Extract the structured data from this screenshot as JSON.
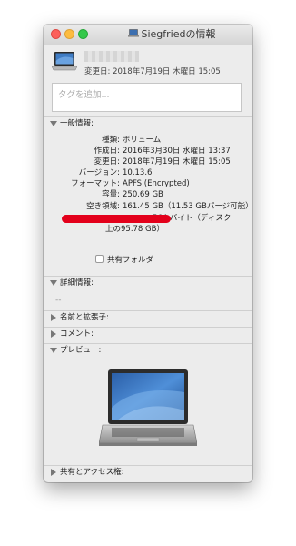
{
  "window": {
    "title": "Siegfriedの情報",
    "modified_line": "変更日:  2018年7月19日 木曜日 15:05",
    "tags_placeholder": "タグを追加..."
  },
  "sections": {
    "general": "一般情報:",
    "more_info": "詳細情報:",
    "more_info_value": "--",
    "name_ext": "名前と拡張子:",
    "comments": "コメント:",
    "preview": "プレビュー:",
    "sharing": "共有とアクセス権:"
  },
  "general": {
    "kind_key": "種類:",
    "kind_val": "ボリューム",
    "created_key": "作成日:",
    "created_val": "2016年3月30日 水曜日 13:37",
    "modified_key": "変更日:",
    "modified_val": "2018年7月19日 木曜日 15:05",
    "version_key": "バージョン:",
    "version_val": "10.13.6",
    "format_key": "フォーマット:",
    "format_val": "APFS (Encrypted)",
    "capacity_key": "容量:",
    "capacity_val": "250.69 GB",
    "free_key": "空き領域:",
    "free_val": "161.45 GB（11.53 GBパージ可能）",
    "used_partial": "564 バイト（ディスク",
    "used_line2": "上の95.78 GB）",
    "shared_folder": "共有フォルダ"
  }
}
